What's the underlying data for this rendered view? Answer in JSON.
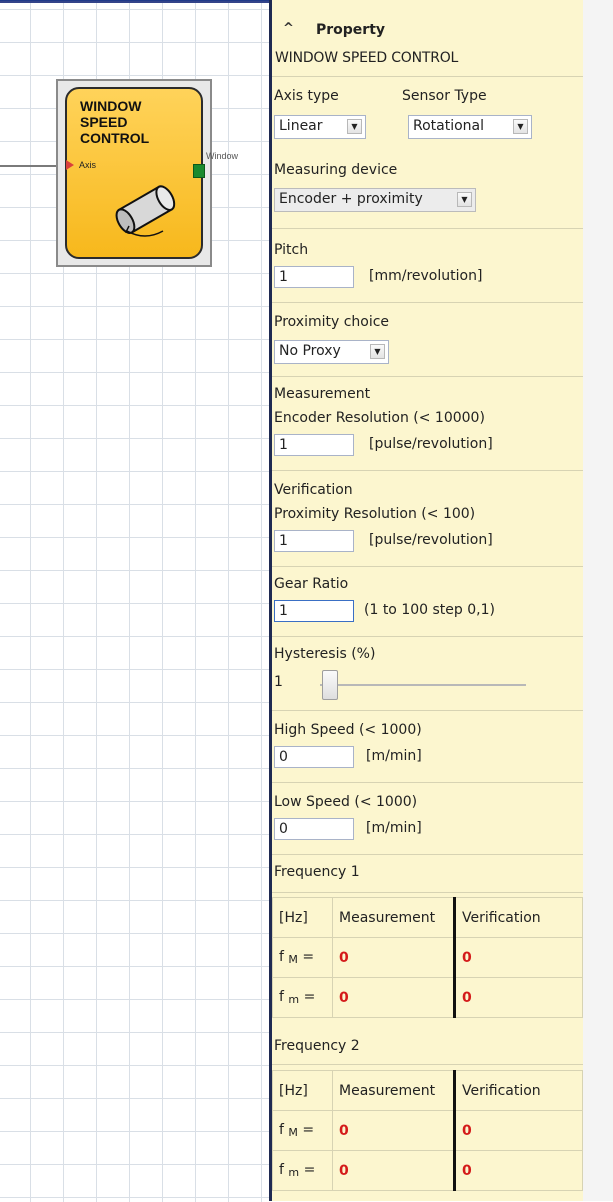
{
  "canvas": {
    "block": {
      "title_lines": [
        "WINDOW",
        "SPEED",
        "CONTROL"
      ],
      "input_pin": "Axis",
      "output_pin": "Window"
    }
  },
  "property": {
    "header": "Property",
    "block_name": "WINDOW SPEED CONTROL",
    "axis_type": {
      "label": "Axis type",
      "value": "Linear"
    },
    "sensor_type": {
      "label": "Sensor Type",
      "value": "Rotational"
    },
    "measuring_device": {
      "label": "Measuring device",
      "value": "Encoder + proximity"
    },
    "pitch": {
      "label": "Pitch",
      "value": "1",
      "unit": "[mm/revolution]"
    },
    "proximity_choice": {
      "label": "Proximity choice",
      "value": "No Proxy"
    },
    "measurement": {
      "label": "Measurement",
      "sub_label": "Encoder Resolution (< 10000)",
      "value": "1",
      "unit": "[pulse/revolution]"
    },
    "verification": {
      "label": "Verification",
      "sub_label": "Proximity Resolution (< 100)",
      "value": "1",
      "unit": "[pulse/revolution]"
    },
    "gear_ratio": {
      "label": "Gear Ratio",
      "value": "1",
      "unit": "(1 to 100 step 0,1)"
    },
    "hysteresis": {
      "label": "Hysteresis (%)",
      "value": "1"
    },
    "high_speed": {
      "label": "High Speed (< 1000)",
      "value": "0",
      "unit": "[m/min]"
    },
    "low_speed": {
      "label": "Low Speed (< 1000)",
      "value": "0",
      "unit": "[m/min]"
    },
    "frequency1": {
      "label": "Frequency 1",
      "headers": [
        "[Hz]",
        "Measurement",
        "Verification"
      ],
      "rows": [
        {
          "name": "f",
          "sub": "M",
          "eq": "=",
          "measurement": "0",
          "verification": "0"
        },
        {
          "name": "f",
          "sub": "m",
          "eq": "=",
          "measurement": "0",
          "verification": "0"
        }
      ]
    },
    "frequency2": {
      "label": "Frequency 2",
      "headers": [
        "[Hz]",
        "Measurement",
        "Verification"
      ],
      "rows": [
        {
          "name": "f",
          "sub": "M",
          "eq": "=",
          "measurement": "0",
          "verification": "0"
        },
        {
          "name": "f",
          "sub": "m",
          "eq": "=",
          "measurement": "0",
          "verification": "0"
        }
      ]
    }
  }
}
